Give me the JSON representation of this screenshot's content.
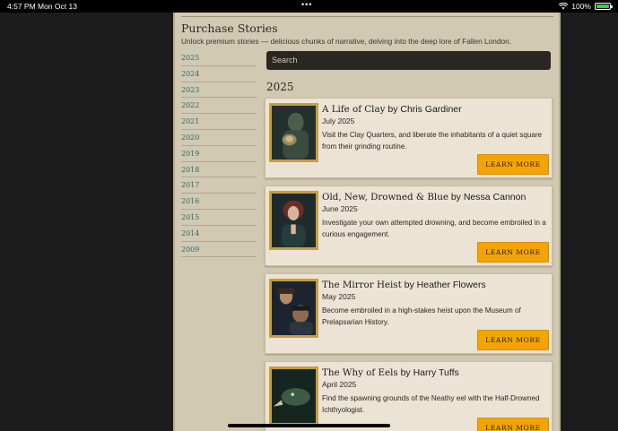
{
  "status_bar": {
    "time": "4:57 PM",
    "date": "Mon Oct 13",
    "dots": "•••",
    "battery_percent": "100%",
    "battery_level": 1.0
  },
  "page": {
    "title": "Purchase Stories",
    "subtitle": "Unlock premium stories — delicious chunks of narrative, delving into the deep lore of Fallen London."
  },
  "years": [
    "2025",
    "2024",
    "2023",
    "2022",
    "2021",
    "2020",
    "2019",
    "2018",
    "2017",
    "2016",
    "2015",
    "2014",
    "2009"
  ],
  "search": {
    "placeholder": "Search"
  },
  "current_year": "2025",
  "stories": [
    {
      "title": "A Life of Clay",
      "by": " by Chris Gardiner",
      "date": "July 2025",
      "description": "Visit the Clay Quarters, and liberate the inhabitants of a quiet square from their grinding routine.",
      "button": "LEARN MORE"
    },
    {
      "title": "Old, New, Drowned & Blue",
      "by": " by Nessa Cannon",
      "date": "June 2025",
      "description": "Investigate your own attempted drowning, and become embroiled in a curious engagement.",
      "button": "LEARN MORE"
    },
    {
      "title": "The Mirror Heist",
      "by": " by Heather Flowers",
      "date": "May 2025",
      "description": "Become embroiled in a high-stakes heist upon the Museum of Prelapsarian History.",
      "button": "LEARN MORE"
    },
    {
      "title": "The Why of Eels",
      "by": " by Harry Tuffs",
      "date": "April 2025",
      "description": "Find the spawning grounds of the Neathy eel with the Half-Drowned Ichthyologist.",
      "button": "LEARN MORE"
    }
  ],
  "colors": {
    "accent_button": "#f4a400",
    "link_year": "#2d6a6c",
    "page_bg": "#d2c9b3",
    "card_bg": "#ebe4d5",
    "frame_gold": "#c69f3b"
  }
}
